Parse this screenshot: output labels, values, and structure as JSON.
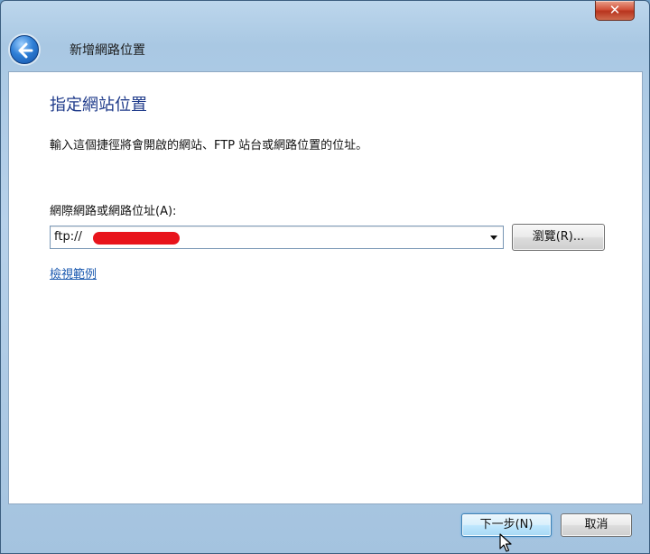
{
  "window": {
    "close_label": "✕"
  },
  "wizard": {
    "title": "新增網路位置",
    "heading": "指定網站位置",
    "description": "輸入這個捷徑將會開啟的網站、FTP 站台或網路位置的位址。",
    "field_label": "網際網路或網路位址(A):",
    "address_value": "ftp://",
    "address_redacted": true,
    "browse_label": "瀏覽(R)...",
    "example_link": "檢視範例"
  },
  "footer": {
    "next_label": "下一步(N)",
    "cancel_label": "取消"
  },
  "colors": {
    "heading": "#1e3a8a",
    "link": "#1c5ab0",
    "redaction": "#e8141c"
  },
  "icons": {
    "back": "back-arrow-icon",
    "close": "close-icon",
    "dropdown": "chevron-down-icon",
    "cursor": "mouse-pointer-icon"
  }
}
